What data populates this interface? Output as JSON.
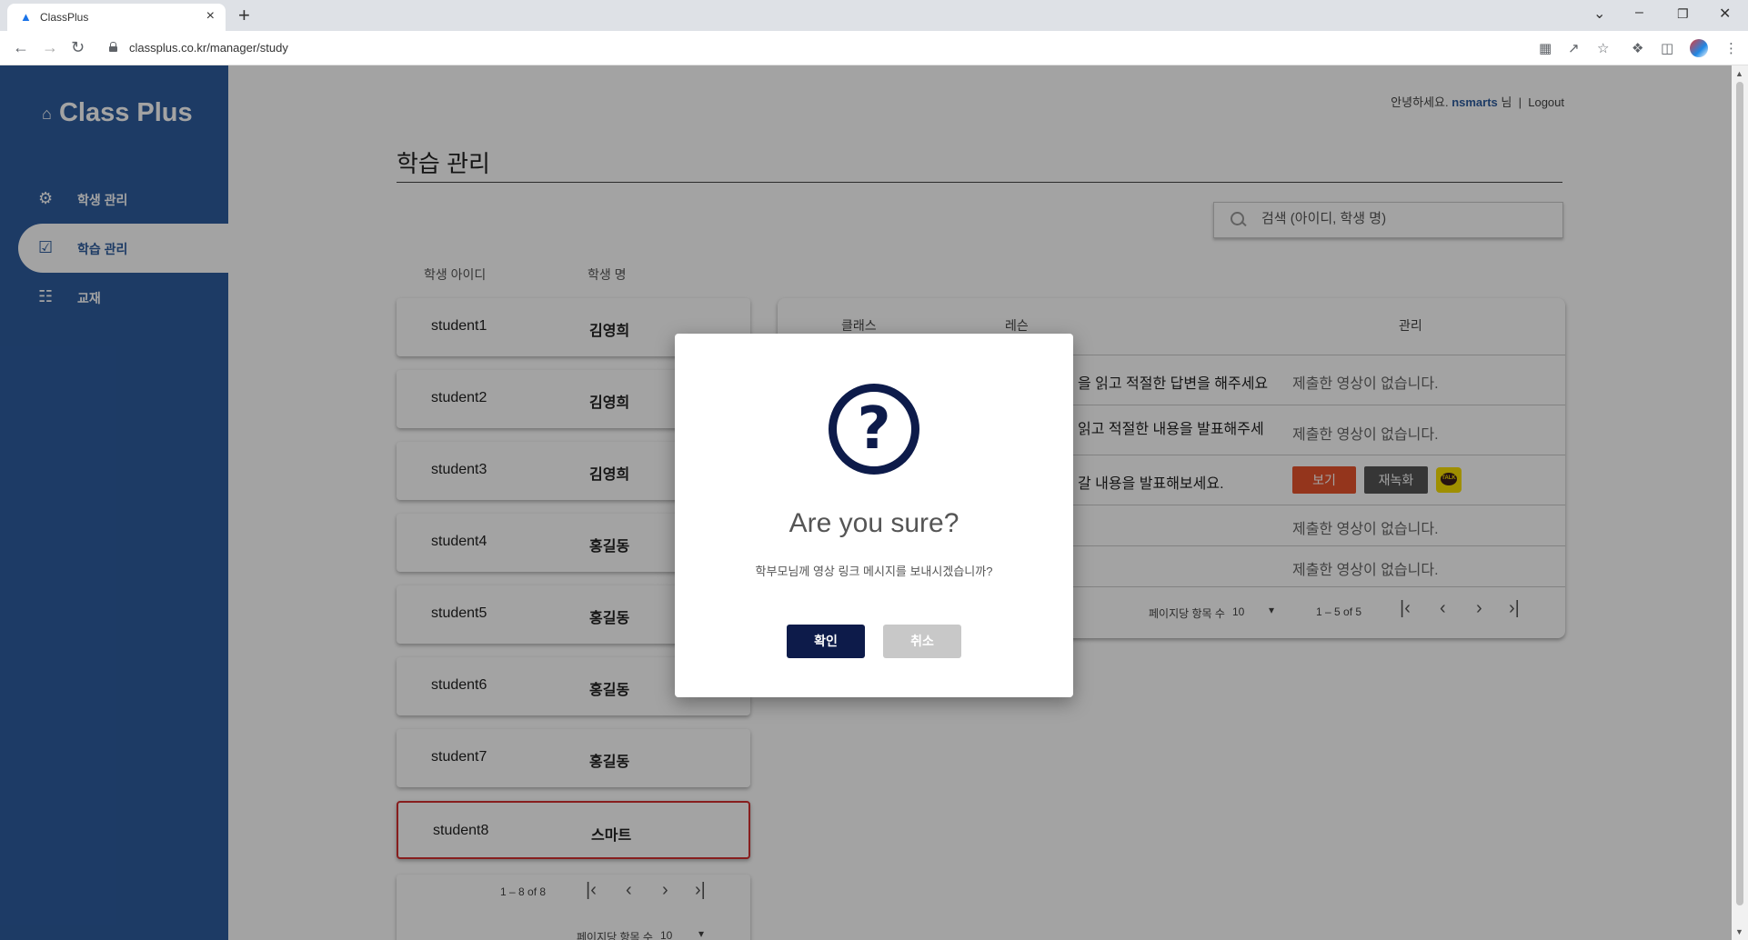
{
  "browser": {
    "tab_title": "ClassPlus",
    "new_tab_symbol": "+",
    "url": "classplus.co.kr/manager/study"
  },
  "sidebar": {
    "logo": "Class Plus",
    "items": [
      {
        "label": "학생 관리",
        "icon": "user-gear-icon"
      },
      {
        "label": "학습 관리",
        "icon": "checklist-icon",
        "active": true
      },
      {
        "label": "교재",
        "icon": "book-icon"
      }
    ]
  },
  "header": {
    "greeting": "안녕하세요.",
    "username": "nsmarts",
    "honorific": "님",
    "separator": "|",
    "logout": "Logout"
  },
  "page_title": "학습 관리",
  "search": {
    "placeholder": "검색 (아이디, 학생 명)"
  },
  "student_list": {
    "headers": {
      "id": "학생 아이디",
      "name": "학생 명"
    },
    "students": [
      {
        "id": "student1",
        "name": "김영희"
      },
      {
        "id": "student2",
        "name": "김영희"
      },
      {
        "id": "student3",
        "name": "김영희"
      },
      {
        "id": "student4",
        "name": "홍길동"
      },
      {
        "id": "student5",
        "name": "홍길동"
      },
      {
        "id": "student6",
        "name": "홍길동"
      },
      {
        "id": "student7",
        "name": "홍길동"
      },
      {
        "id": "student8",
        "name": "스마트",
        "selected": true
      }
    ],
    "pager": {
      "range": "1 – 8 of 8",
      "per_page_label": "페이지당 항목 수",
      "per_page_value": "10"
    }
  },
  "lesson_table": {
    "headers": {
      "class": "클래스",
      "lesson": "레슨",
      "manage": "관리"
    },
    "rows": [
      {
        "lesson": "을 읽고 적절한 답변을 해주세요",
        "manage": "제출한 영상이 없습니다."
      },
      {
        "lesson": " 읽고 적절한 내용을 발표해주세",
        "manage": "제출한 영상이 없습니다."
      },
      {
        "lesson": "갈 내용을 발표해보세요.",
        "view": "보기",
        "rerecord": "재녹화",
        "talk": "TALK"
      },
      {
        "lesson": "",
        "manage": "제출한 영상이 없습니다."
      },
      {
        "lesson": "",
        "manage": "제출한 영상이 없습니다."
      }
    ],
    "pager": {
      "per_page_label": "페이지당 항목 수",
      "per_page_value": "10",
      "range": "1 – 5 of 5"
    }
  },
  "modal": {
    "icon": "question-circle-icon",
    "icon_glyph": "?",
    "title": "Are you sure?",
    "text": "학부모님께 영상 링크 메시지를 보내시겠습니까?",
    "confirm": "확인",
    "cancel": "취소"
  },
  "colors": {
    "sidebar": "#2e5d9f",
    "primary_dark": "#0d1b4a",
    "view_button": "#e8542d",
    "selected_border": "#d32f2f"
  }
}
